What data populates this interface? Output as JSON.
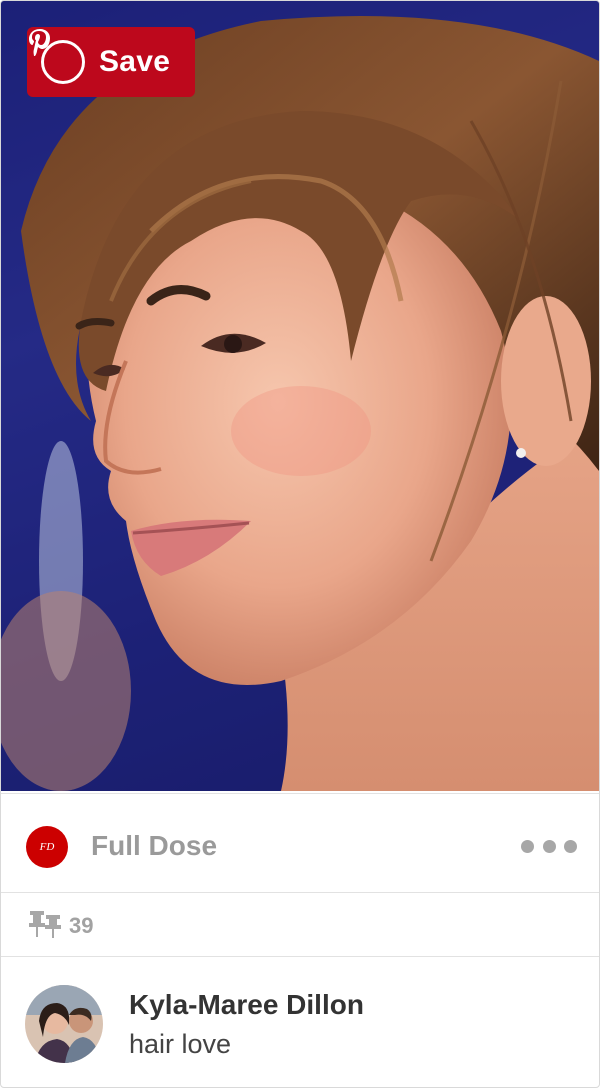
{
  "save_button": {
    "label": "Save",
    "icon": "pinterest-logo-icon",
    "color": "#bd081c"
  },
  "source": {
    "avatar_text": "FD",
    "name": "Full Dose",
    "avatar_color": "#cc0000",
    "menu_icon": "more-dots-icon"
  },
  "stats": {
    "repin_icon": "pin-icon",
    "repins": "39"
  },
  "pinner": {
    "name": "Kyla-Maree Dillon",
    "board": "hair love"
  }
}
